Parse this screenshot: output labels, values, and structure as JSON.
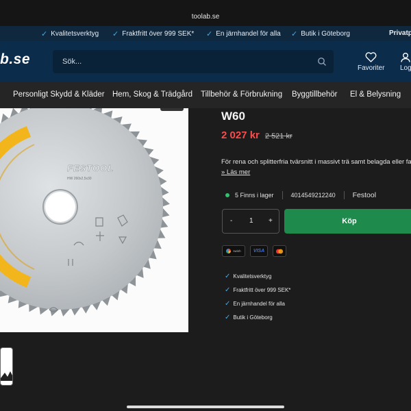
{
  "browser": {
    "domain": "toolab.se"
  },
  "usp_bar": {
    "items": [
      "Kvalitetsverktyg",
      "Fraktfritt över 999 SEK*",
      "En järnhandel för alla",
      "Butik i Göteborg"
    ],
    "right_link": "Privatp"
  },
  "header": {
    "logo_text": "b.se",
    "search_placeholder": "Sök...",
    "favorites_label": "Favoriter",
    "login_label": "Log"
  },
  "nav": {
    "items": [
      "Personligt Skydd & Kläder",
      "Hem, Skog & Trädgård",
      "Tillbehör & Förbrukning",
      "Byggtillbehör",
      "El & Belysning"
    ]
  },
  "product": {
    "image_brand": "FESTOOL",
    "image_model": "HW 260x2,5x30",
    "title": "W60",
    "price": "2 027 kr",
    "old_price": "2 521 kr",
    "description": "För rena och splitterfria tvärsnitt i massivt trä samt belagda eller fan",
    "read_more": "» Läs mer",
    "stock_text": "5 Finns i lager",
    "ean": "4014549212240",
    "brand": "Festool",
    "quantity": "1",
    "qty_minus": "-",
    "qty_plus": "+",
    "buy_label": "Köp"
  },
  "payments": {
    "swish": "swish",
    "visa": "VISA"
  },
  "usp_list": [
    "Kvalitetsverktyg",
    "Fraktfritt över 999 SEK*",
    "En järnhandel för alla",
    "Butik i Göteborg"
  ],
  "colors": {
    "accent_blue": "#0c2c4c",
    "buy_green": "#1e8a4c",
    "price_red": "#ff4a4a",
    "stock_green": "#31c26f"
  }
}
